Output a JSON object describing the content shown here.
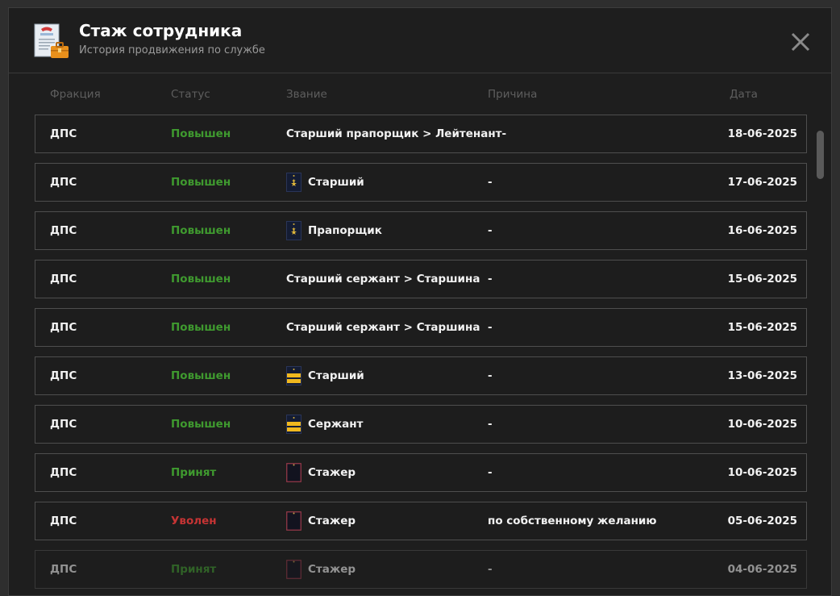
{
  "header": {
    "title": "Стаж сотрудника",
    "subtitle": "История продвижения по службе",
    "icon": "document-briefcase-icon",
    "close_icon": "close-icon"
  },
  "columns": {
    "faction": "Фракция",
    "status": "Статус",
    "rank": "Звание",
    "reason": "Причина",
    "date": "Дата"
  },
  "colors": {
    "promoted": "#3f9a2f",
    "fired": "#c63434",
    "background": "#1e1e1e"
  },
  "rows": [
    {
      "faction": "ДПС",
      "status": "Повышен",
      "status_type": "green",
      "rank": "Старший прапорщик > Лейтенант-",
      "badge": "none",
      "reason": "",
      "date": "18-06-2025"
    },
    {
      "faction": "ДПС",
      "status": "Повышен",
      "status_type": "green",
      "rank": "Старший",
      "badge": "navy-star-badge",
      "reason": "-",
      "date": "17-06-2025"
    },
    {
      "faction": "ДПС",
      "status": "Повышен",
      "status_type": "green",
      "rank": "Прапорщик",
      "badge": "navy-star-badge",
      "reason": "-",
      "date": "16-06-2025"
    },
    {
      "faction": "ДПС",
      "status": "Повышен",
      "status_type": "green",
      "rank": "Старший сержант > Старшина",
      "badge": "none",
      "reason": "-",
      "date": "15-06-2025"
    },
    {
      "faction": "ДПС",
      "status": "Повышен",
      "status_type": "green",
      "rank": "Старший сержант > Старшина",
      "badge": "none",
      "reason": "-",
      "date": "15-06-2025"
    },
    {
      "faction": "ДПС",
      "status": "Повышен",
      "status_type": "green",
      "rank": "Старший",
      "badge": "gold-stripe-badge",
      "reason": "-",
      "date": "13-06-2025"
    },
    {
      "faction": "ДПС",
      "status": "Повышен",
      "status_type": "green",
      "rank": "Сержант",
      "badge": "gold-stripe-badge",
      "reason": "-",
      "date": "10-06-2025"
    },
    {
      "faction": "ДПС",
      "status": "Принят",
      "status_type": "green",
      "rank": "Стажер",
      "badge": "trainee-badge",
      "reason": "-",
      "date": "10-06-2025"
    },
    {
      "faction": "ДПС",
      "status": "Уволен",
      "status_type": "red",
      "rank": "Стажер",
      "badge": "trainee-badge",
      "reason": "по собственному желанию",
      "date": "05-06-2025"
    },
    {
      "faction": "ДПС",
      "status": "Принят",
      "status_type": "green",
      "rank": "Стажер",
      "badge": "trainee-badge",
      "reason": "-",
      "date": "04-06-2025"
    }
  ]
}
